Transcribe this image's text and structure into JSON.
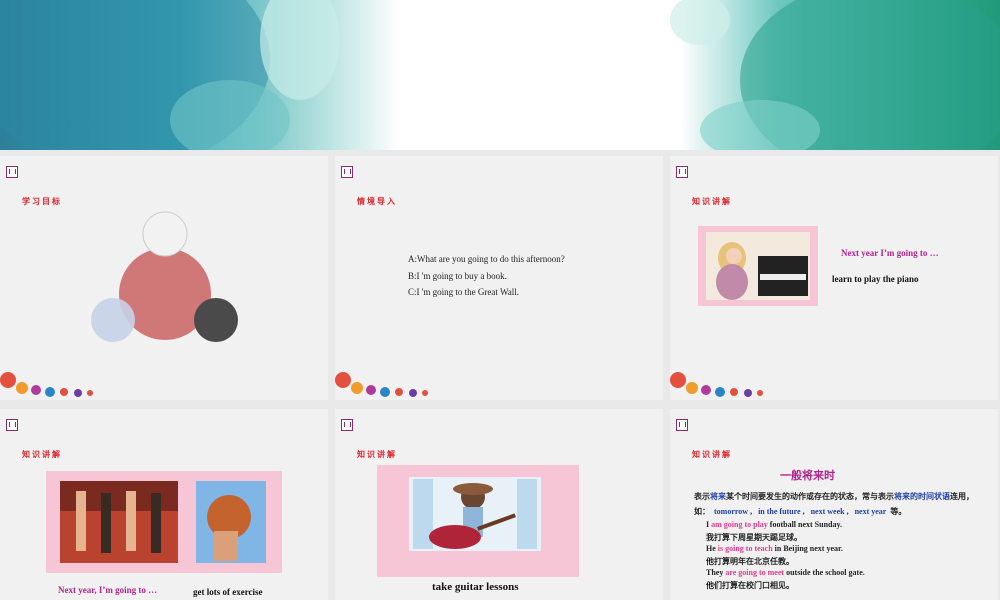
{
  "colors": {
    "accent_red": "#d8262b",
    "magenta": "#b0248c",
    "blue": "#1e3fa8",
    "pink": "#e23b8b"
  },
  "slide1": {
    "title": "学习目标"
  },
  "slide2": {
    "title": "情境导入",
    "lines": [
      "A:What are you going to do this afternoon?",
      "B:I 'm going to buy a book.",
      "C:I 'm going to the Great Wall."
    ]
  },
  "slide3": {
    "title": "知识讲解",
    "heading": "Next year I’m going to …",
    "caption": "learn to play the piano"
  },
  "slide4": {
    "title": "知识讲解",
    "heading": "Next year, I’m going to …",
    "caption": "get lots of exercise"
  },
  "slide5": {
    "title": "知识讲解",
    "caption": "take guitar lessons"
  },
  "slide6": {
    "title": "知识讲解",
    "heading": "一般将来时",
    "def_1": "表示",
    "def_2": "将来",
    "def_3": "某个时间要发生的动作或存在的状态，常与表示",
    "def_4": "将来的时间状语",
    "def_5": "连用，",
    "ex_prefix": "如：",
    "adverbs": [
      "tomorrow",
      "in the future",
      "next week",
      "next year"
    ],
    "ex_suffix": "等。",
    "s1_a": "I ",
    "s1_b": "am going to play",
    "s1_c": " football next Sunday.",
    "s1_cn": "我打算下周星期天踢足球。",
    "s2_a": "He ",
    "s2_b": "is going to teach",
    "s2_c": " in Beijing next year.",
    "s2_cn": "他打算明年在北京任教。",
    "s3_a": "They ",
    "s3_b": "are going to meet",
    "s3_c": " outside the school gate.",
    "s3_cn": "他们打算在校门口相见。"
  }
}
